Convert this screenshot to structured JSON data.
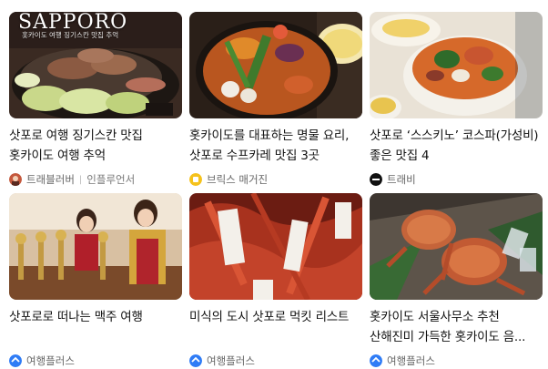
{
  "cards": [
    {
      "thumb_icon": "jingisukan-grill-photo",
      "thumb_overlay_title": "SAPPORO",
      "thumb_overlay_sub": "홋카이도 여행 징기스칸 맛집 추억",
      "title": "삿포로 여행 징기스칸 맛집 홋카이도 여행 추억",
      "source_name": "트래블러버",
      "source_tag": "인플루언서",
      "source_icon": "avatar-travelover-icon"
    },
    {
      "thumb_icon": "soup-curry-bowl-photo",
      "title": "홋카이도를 대표하는 명물 요리, 삿포로 수프카레 맛집 3곳",
      "source_name": "브릭스 매거진",
      "source_icon": "bricks-magazine-icon"
    },
    {
      "thumb_icon": "soup-curry-susukino-photo",
      "title": "삿포로 ‘스스키노’ 코스파(가성비) 좋은 맛집 4",
      "source_name": "트래비",
      "source_icon": "travie-logo-icon"
    },
    {
      "thumb_icon": "beer-taps-photo",
      "title": "삿포로로 떠나는 맥주 여행",
      "source_name": "여행플러스",
      "source_icon": "travel-plus-icon"
    },
    {
      "thumb_icon": "king-crab-market-photo",
      "title": "미식의 도시 삿포로 먹킷 리스트",
      "source_name": "여행플러스",
      "source_icon": "travel-plus-icon"
    },
    {
      "thumb_icon": "hairy-crab-photo",
      "title": "홋카이도 서울사무소 추천 산해진미 가득한 홋카이도 음...",
      "source_name": "여행플러스",
      "source_icon": "travel-plus-icon"
    }
  ]
}
